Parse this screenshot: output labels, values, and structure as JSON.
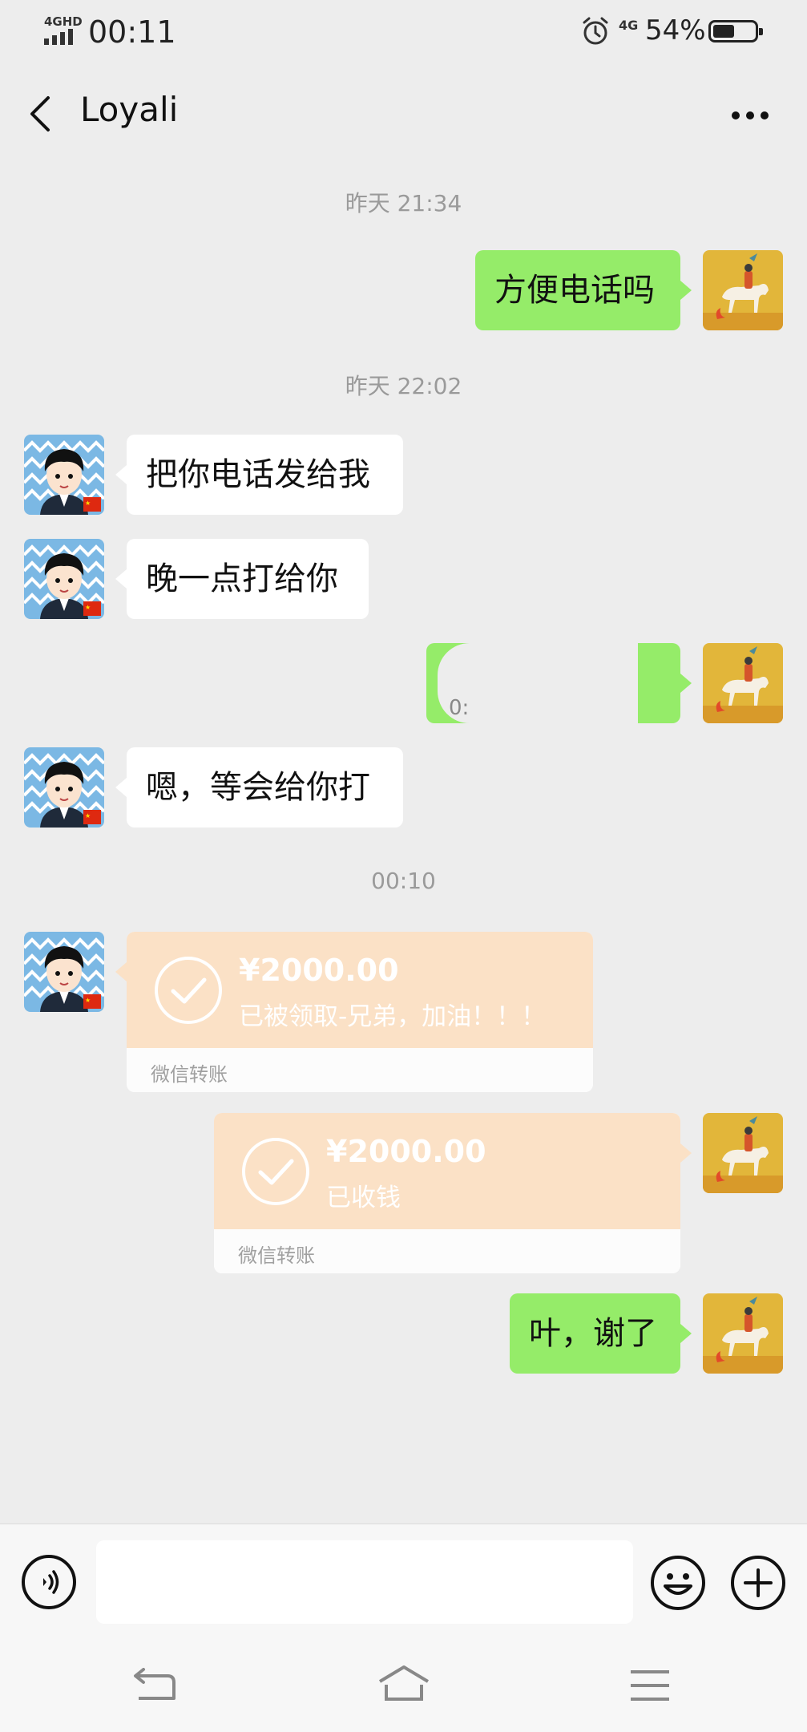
{
  "status_bar": {
    "network_label": "4GHD",
    "time": "00:11",
    "network_right": "4G",
    "battery_percent": "54%",
    "battery_level": 0.54
  },
  "header": {
    "contact_name": "Loyali"
  },
  "messages": {
    "stamp1": "昨天 21:34",
    "m1_text": "方便电话吗",
    "stamp2": "昨天 22:02",
    "m2_text": "把你电话发给我",
    "m3_text": "晚一点打给你",
    "m4_partial": "0:",
    "m5_text": "嗯，等会给你打",
    "stamp3": "00:10",
    "t1_amount": "¥2000.00",
    "t1_note": "已被领取-兄弟，加油！！！",
    "t1_brand": "微信转账",
    "t2_amount": "¥2000.00",
    "t2_note": "已收钱",
    "t2_brand": "微信转账",
    "m6_text": "叶，谢了"
  },
  "colors": {
    "outgoing_bubble": "#95ec69",
    "incoming_bubble": "#ffffff",
    "transfer_card": "#fbe1c6",
    "background": "#ededed"
  },
  "icons": {
    "voice": "voice-icon",
    "emoji": "emoji-icon",
    "plus": "plus-icon"
  }
}
